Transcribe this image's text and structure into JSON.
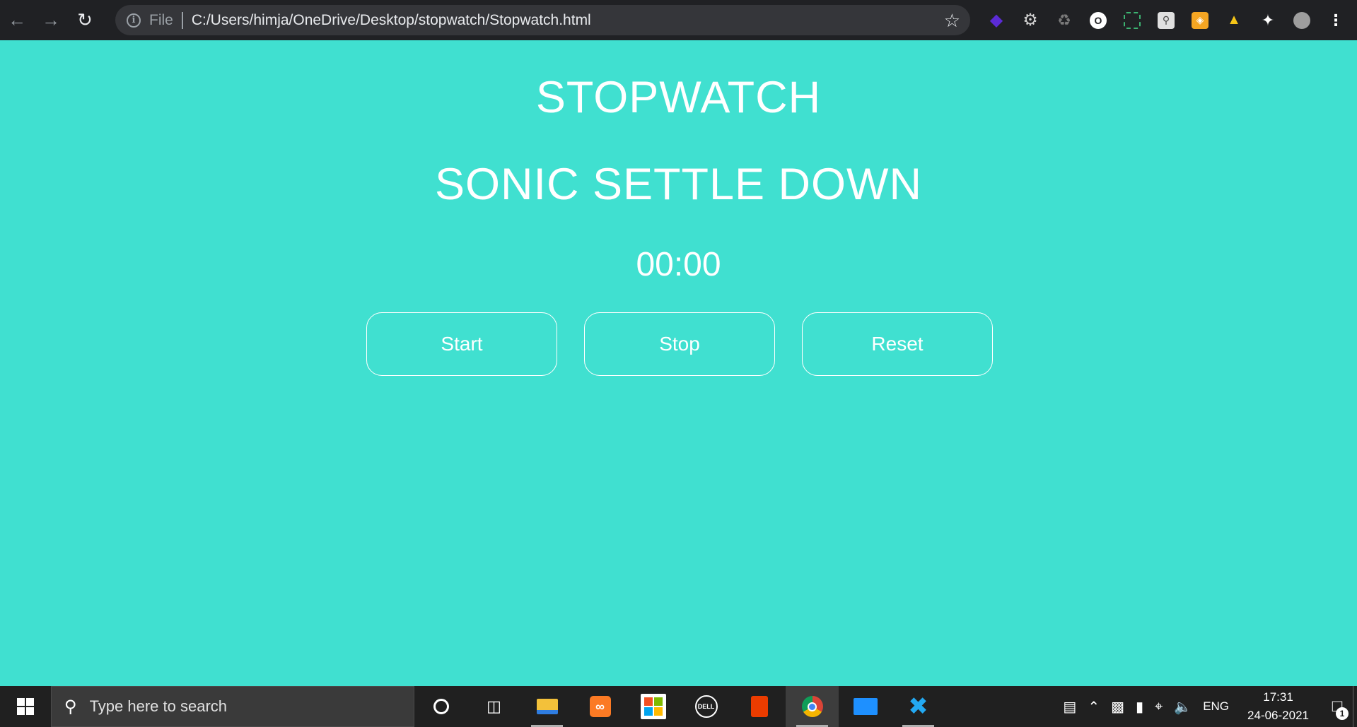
{
  "browser": {
    "file_label": "File",
    "url": "C:/Users/himja/OneDrive/Desktop/stopwatch/Stopwatch.html",
    "extensions": [
      {
        "name": "purple-gem-extension-icon",
        "color": "#5b2bd6"
      },
      {
        "name": "gear-extension-icon",
        "color": "#bdbdbd"
      },
      {
        "name": "recycle-extension-icon",
        "color": "#7a7a7a"
      },
      {
        "name": "circle-o-extension-icon",
        "color": "#ffffff"
      },
      {
        "name": "screenshot-extension-icon",
        "color": "#3cb371"
      },
      {
        "name": "image-search-extension-icon",
        "color": "#e0e0e0"
      },
      {
        "name": "orange-shield-extension-icon",
        "color": "#f5a623"
      },
      {
        "name": "thumbs-up-extension-icon",
        "color": "#f5c518"
      },
      {
        "name": "puzzle-extensions-icon",
        "color": "#ffffff"
      },
      {
        "name": "profile-avatar-icon",
        "color": "#9e9e9e"
      }
    ]
  },
  "page": {
    "title": "STOPWATCH",
    "subtitle": "SONIC SETTLE DOWN",
    "display": "00:00",
    "buttons": {
      "start": "Start",
      "stop": "Stop",
      "reset": "Reset"
    },
    "background_color": "#40e0d0",
    "text_color": "#ffffff"
  },
  "taskbar": {
    "search_placeholder": "Type here to search",
    "apps": [
      "cortana-icon",
      "task-view-icon",
      "file-explorer-icon",
      "xampp-icon",
      "microsoft-store-icon",
      "dell-icon",
      "office-icon",
      "chrome-icon",
      "mail-icon",
      "vscode-icon"
    ],
    "tray": {
      "language": "ENG",
      "time": "17:31",
      "date": "24-06-2021",
      "notifications": "1"
    }
  }
}
